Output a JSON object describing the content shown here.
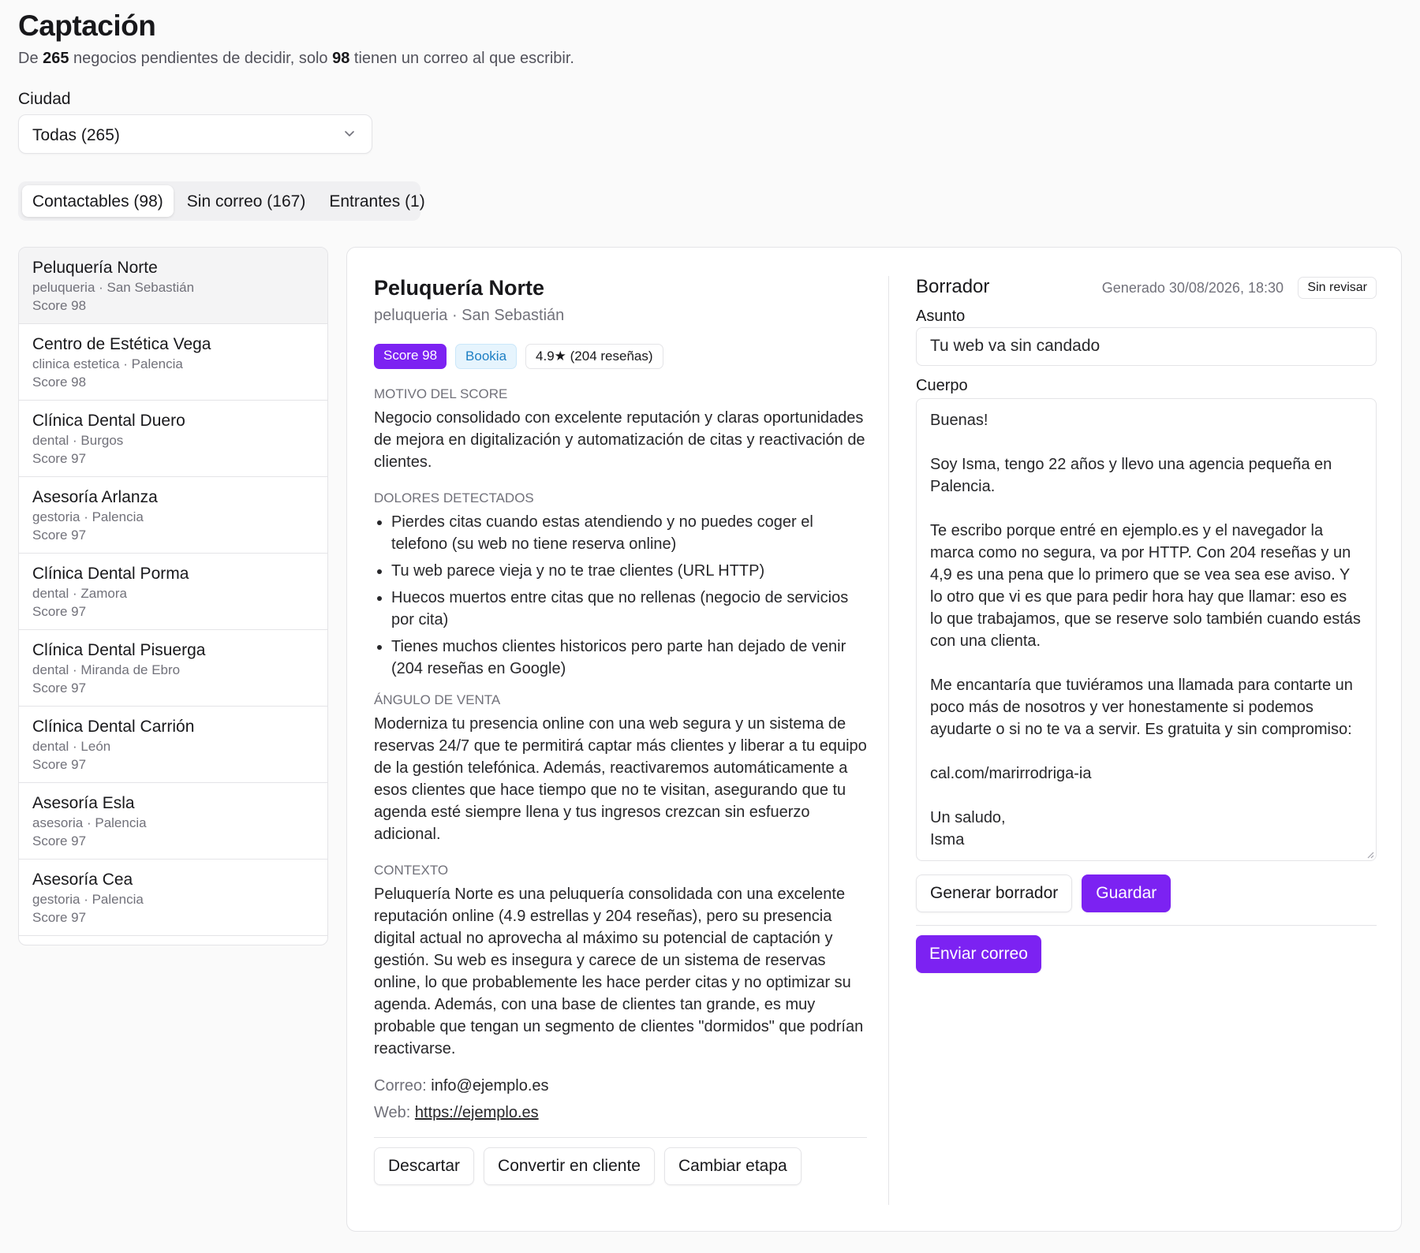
{
  "header": {
    "title": "Captación",
    "subtitle_pre": "De ",
    "pending_count": "265",
    "subtitle_mid": " negocios pendientes de decidir, solo ",
    "email_count": "98",
    "subtitle_post": " tienen un correo al que escribir."
  },
  "filter": {
    "label": "Ciudad",
    "selected": "Todas (265)",
    "icon": "chevron-down-icon"
  },
  "tabs": [
    {
      "label": "Contactables (98)",
      "active": true
    },
    {
      "label": "Sin correo (167)",
      "active": false
    },
    {
      "label": "Entrantes (1)",
      "active": false
    }
  ],
  "leads": [
    {
      "name": "Peluquería Norte",
      "meta": "peluqueria · San Sebastián",
      "score": "Score 98",
      "selected": true
    },
    {
      "name": "Centro de Estética Vega",
      "meta": "clinica estetica · Palencia",
      "score": "Score 98"
    },
    {
      "name": "Clínica Dental Duero",
      "meta": "dental · Burgos",
      "score": "Score 97"
    },
    {
      "name": "Asesoría Arlanza",
      "meta": "gestoria · Palencia",
      "score": "Score 97"
    },
    {
      "name": "Clínica Dental Porma",
      "meta": "dental · Zamora",
      "score": "Score 97"
    },
    {
      "name": "Clínica Dental Pisuerga",
      "meta": "dental · Miranda de Ebro",
      "score": "Score 97"
    },
    {
      "name": "Clínica Dental Carrión",
      "meta": "dental · León",
      "score": "Score 97"
    },
    {
      "name": "Asesoría Esla",
      "meta": "asesoria · Palencia",
      "score": "Score 97"
    },
    {
      "name": "Asesoría Cea",
      "meta": "gestoria · Palencia",
      "score": "Score 97"
    }
  ],
  "detail": {
    "name": "Peluquería Norte",
    "meta": "peluqueria · San Sebastián",
    "badges": {
      "score": "Score 98",
      "tool": "Bookia",
      "rating": "4.9★ (204 reseñas)"
    },
    "score_reason_label": "Motivo del score",
    "score_reason": "Negocio consolidado con excelente reputación y claras oportunidades de mejora en digitalización y automatización de citas y reactivación de clientes.",
    "pains_label": "Dolores detectados",
    "pains": [
      "Pierdes citas cuando estas atendiendo y no puedes coger el telefono (su web no tiene reserva online)",
      "Tu web parece vieja y no te trae clientes (URL HTTP)",
      "Huecos muertos entre citas que no rellenas (negocio de servicios por cita)",
      "Tienes muchos clientes historicos pero parte han dejado de venir (204 reseñas en Google)"
    ],
    "angle_label": "Ángulo de venta",
    "angle": "Moderniza tu presencia online con una web segura y un sistema de reservas 24/7 que te permitirá captar más clientes y liberar a tu equipo de la gestión telefónica. Además, reactivaremos automáticamente a esos clientes que hace tiempo que no te visitan, asegurando que tu agenda esté siempre llena y tus ingresos crezcan sin esfuerzo adicional.",
    "context_label": "Contexto",
    "context": "Peluquería Norte es una peluquería consolidada con una excelente reputación online (4.9 estrellas y 204 reseñas), pero su presencia digital actual no aprovecha al máximo su potencial de captación y gestión. Su web es insegura y carece de un sistema de reservas online, lo que probablemente les hace perder citas y no optimizar su agenda. Además, con una base de clientes tan grande, es muy probable que tengan un segmento de clientes \"dormidos\" que podrían reactivarse.",
    "email_label": "Correo:",
    "email": "info@ejemplo.es",
    "web_label": "Web:",
    "web": "https://ejemplo.es",
    "actions": {
      "discard": "Descartar",
      "convert": "Convertir en cliente",
      "change_stage": "Cambiar etapa"
    }
  },
  "draft": {
    "title": "Borrador",
    "generated": "Generado 30/08/2026, 18:30",
    "status": "Sin revisar",
    "subject_label": "Asunto",
    "subject": "Tu web va sin candado",
    "body_label": "Cuerpo",
    "body": [
      "Buenas!",
      "Soy Isma, tengo 22 años y llevo una agencia pequeña en Palencia.",
      "Te escribo porque entré en ejemplo.es y el navegador la marca como no segura, va por HTTP. Con 204 reseñas y un 4,9 es una pena que lo primero que se vea sea ese aviso. Y lo otro que vi es que para pedir hora hay que llamar: eso es lo que trabajamos, que se reserve solo también cuando estás con una clienta.",
      "Me encantaría que tuviéramos una llamada para contarte un poco más de nosotros y ver honestamente si podemos ayudarte o si no te va a servir. Es gratuita y sin compromiso:",
      "cal.com/marirrodriga-ia"
    ],
    "signoff": "Un saludo,",
    "signature": "Isma",
    "generate_label": "Generar borrador",
    "save_label": "Guardar",
    "send_label": "Enviar correo"
  },
  "colors": {
    "accent": "#7c22f2",
    "tool_badge_bg": "#e6f4fd",
    "tool_badge_text": "#1d7fc4",
    "border": "#e4e4e7",
    "muted_text": "#71717a"
  }
}
